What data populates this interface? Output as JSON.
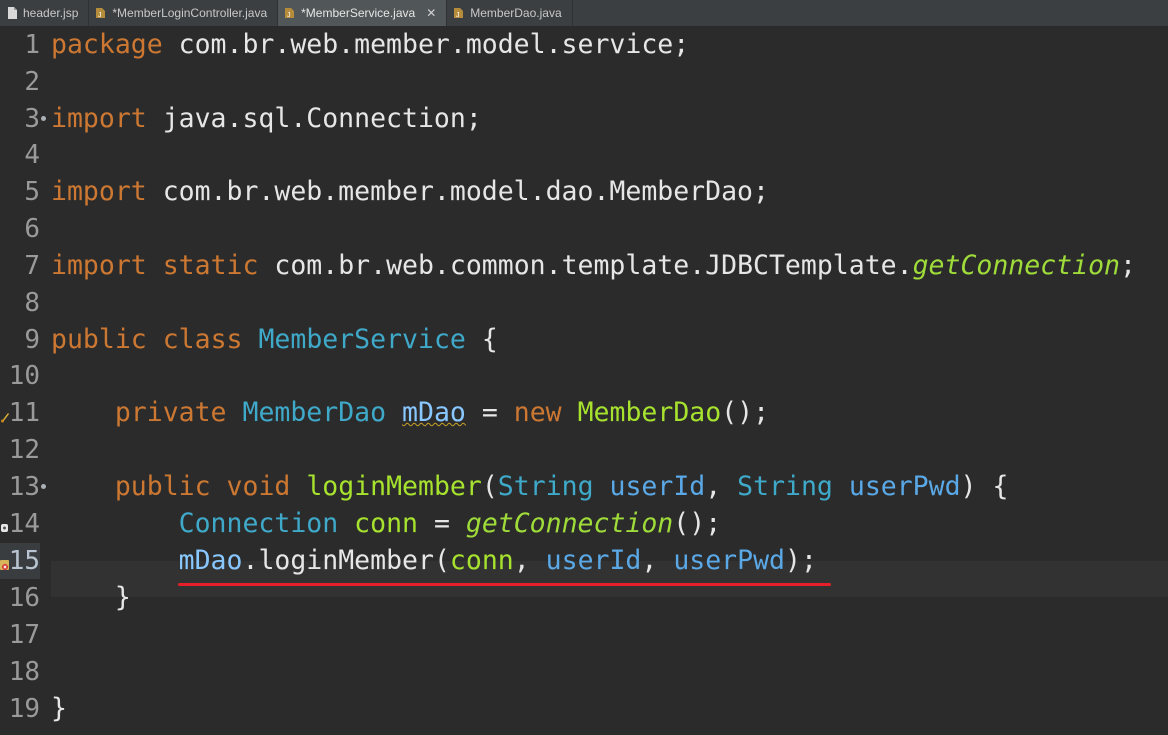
{
  "tabs": [
    {
      "label": "header.jsp",
      "icon": "jsp-file-icon",
      "active": false
    },
    {
      "label": "*MemberLoginController.java",
      "icon": "java-file-icon",
      "active": false
    },
    {
      "label": "*MemberService.java",
      "icon": "java-file-icon",
      "active": true,
      "close": "✕"
    },
    {
      "label": "MemberDao.java",
      "icon": "java-file-icon",
      "active": false
    }
  ],
  "lines": [
    {
      "num": "1"
    },
    {
      "num": "2"
    },
    {
      "num": "3"
    },
    {
      "num": "4"
    },
    {
      "num": "5"
    },
    {
      "num": "6"
    },
    {
      "num": "7"
    },
    {
      "num": "8"
    },
    {
      "num": "9"
    },
    {
      "num": "10"
    },
    {
      "num": "11"
    },
    {
      "num": "12"
    },
    {
      "num": "13"
    },
    {
      "num": "14"
    },
    {
      "num": "15"
    },
    {
      "num": "16"
    },
    {
      "num": "17"
    },
    {
      "num": "18"
    },
    {
      "num": "19"
    }
  ],
  "code": {
    "l1": {
      "kw": "package",
      "rest": " com.br.web.member.model.service;"
    },
    "l3": {
      "kw": "import",
      "rest": " java.sql.Connection;"
    },
    "l5": {
      "kw": "import",
      "rest": " com.br.web.member.model.dao.MemberDao;"
    },
    "l7": {
      "kw1": "import",
      "kw2": "static",
      "pkg": " com.br.web.common.template.JDBCTemplate.",
      "method": "getConnection",
      "end": ";"
    },
    "l9": {
      "kw1": "public",
      "kw2": "class",
      "type": "MemberService",
      "end": " {"
    },
    "l11": {
      "kw1": "private",
      "type": "MemberDao",
      "field": "mDao",
      "op": " = ",
      "kw2": "new",
      "ctor": "MemberDao",
      "end": "();"
    },
    "l13": {
      "kw1": "public",
      "kw2": "void",
      "method": "loginMember",
      "open": "(",
      "t1": "String",
      "p1": "userId",
      "comma": ", ",
      "t2": "String",
      "p2": "userPwd",
      "end": ") {"
    },
    "l14": {
      "type": "Connection",
      "var": "conn",
      "op": " = ",
      "method": "getConnection",
      "end": "();"
    },
    "l15": {
      "obj": "mDao",
      "dot": ".",
      "method": "loginMember",
      "open": "(",
      "a1": "conn",
      "c1": ", ",
      "a2": "userId",
      "c2": ", ",
      "a3": "userPwd",
      "end": ");"
    },
    "l16": {
      "text": "}"
    },
    "l19": {
      "text": "}"
    }
  },
  "colors": {
    "keyword": "#cc7832",
    "type": "#3fa9c9",
    "method": "#a6e22e",
    "error_underline": "#e5202a"
  }
}
